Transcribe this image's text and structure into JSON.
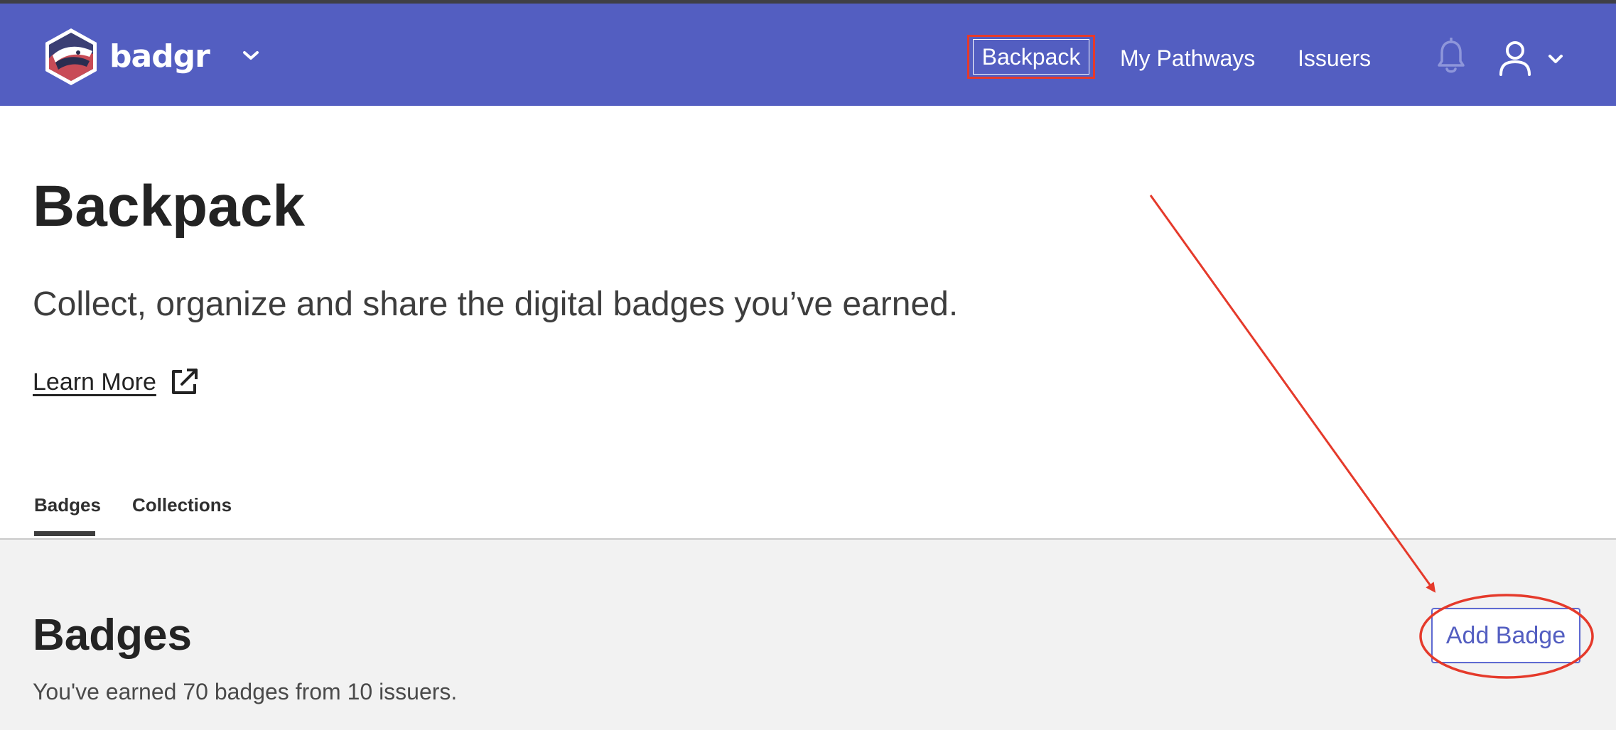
{
  "theme": {
    "navbar_bg": "#535ec1",
    "annotation_red": "#e53a2b",
    "section_bg": "#f2f2f2",
    "accent": "#535ec1"
  },
  "header": {
    "logo_text": "badgr",
    "nav": {
      "backpack": "Backpack",
      "pathways": "My Pathways",
      "issuers": "Issuers"
    },
    "icons": {
      "logo": "badger-logo-icon",
      "caret": "chevron-down-icon",
      "bell": "bell-icon",
      "user": "user-icon"
    }
  },
  "hero": {
    "title": "Backpack",
    "subtitle": "Collect, organize and share the digital badges you’ve earned.",
    "learn_more": "Learn More",
    "learn_more_icon": "external-link-icon"
  },
  "tabs": {
    "badges": "Badges",
    "collections": "Collections",
    "active": "Badges"
  },
  "badges_section": {
    "title": "Badges",
    "summary": "You've earned 70 badges from 10 issuers.",
    "add_button": "Add Badge"
  }
}
